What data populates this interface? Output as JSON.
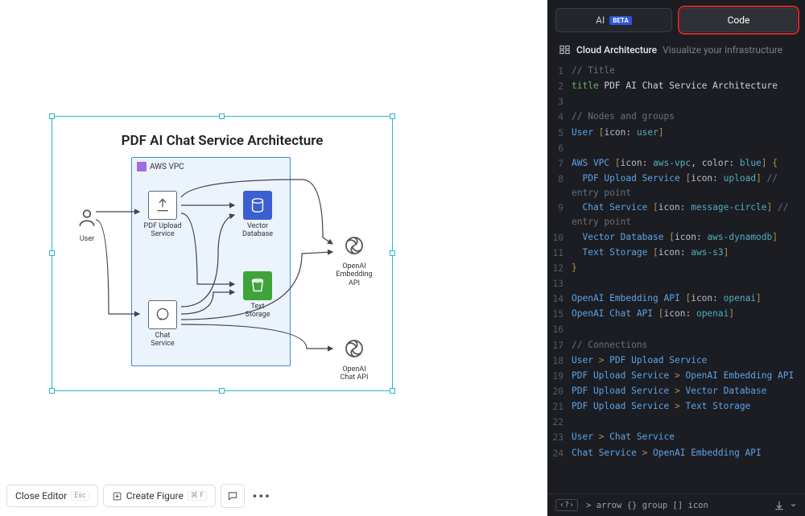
{
  "tabs": {
    "ai": "AI",
    "beta": "BETA",
    "code": "Code"
  },
  "header": {
    "title": "Cloud Architecture",
    "subtitle": "Visualize your infrastructure"
  },
  "diagram": {
    "title": "PDF AI Chat Service Architecture",
    "vpc_label": "AWS VPC",
    "nodes": {
      "user": "User",
      "pdf_upload": "PDF Upload Service",
      "vector_db": "Vector Database",
      "text_storage": "Text Storage",
      "chat_service": "Chat Service",
      "openai_emb": "OpenAI Embedding API",
      "openai_chat": "OpenAI Chat API"
    }
  },
  "toolbar": {
    "close_editor": "Close Editor",
    "close_kbd": "Esc",
    "create_figure": "Create Figure",
    "figure_kbd": "⌘ F"
  },
  "footer": {
    "lang_hint": "‹?›",
    "hint": "> arrow {} group [] icon"
  },
  "code": [
    {
      "n": 1,
      "segs": [
        {
          "c": "cmt",
          "t": "// Title"
        }
      ]
    },
    {
      "n": 2,
      "segs": [
        {
          "c": "kw",
          "t": "title"
        },
        {
          "c": "txt",
          "t": " PDF AI Chat Service Architecture"
        }
      ]
    },
    {
      "n": 3,
      "segs": [
        {
          "c": "",
          "t": ""
        }
      ]
    },
    {
      "n": 4,
      "segs": [
        {
          "c": "cmt",
          "t": "// Nodes and groups"
        }
      ]
    },
    {
      "n": 5,
      "segs": [
        {
          "c": "name",
          "t": "User "
        },
        {
          "c": "brkt",
          "t": "["
        },
        {
          "c": "iconv",
          "t": "icon: "
        },
        {
          "c": "punct",
          "t": "user"
        },
        {
          "c": "brkt",
          "t": "]"
        }
      ]
    },
    {
      "n": 6,
      "segs": [
        {
          "c": "",
          "t": ""
        }
      ]
    },
    {
      "n": 7,
      "segs": [
        {
          "c": "name",
          "t": "AWS VPC "
        },
        {
          "c": "brkt",
          "t": "["
        },
        {
          "c": "iconv",
          "t": "icon: "
        },
        {
          "c": "punct",
          "t": "aws-vpc"
        },
        {
          "c": "iconv",
          "t": ", color: "
        },
        {
          "c": "punct",
          "t": "blue"
        },
        {
          "c": "brkt",
          "t": "]"
        },
        {
          "c": "brkt",
          "t": " {"
        }
      ]
    },
    {
      "n": 8,
      "segs": [
        {
          "c": "",
          "t": "  "
        },
        {
          "c": "name",
          "t": "PDF Upload Service "
        },
        {
          "c": "brkt",
          "t": "["
        },
        {
          "c": "iconv",
          "t": "icon: "
        },
        {
          "c": "punct",
          "t": "upload"
        },
        {
          "c": "brkt",
          "t": "]"
        },
        {
          "c": "cmt",
          "t": " // entry point"
        }
      ]
    },
    {
      "n": 9,
      "segs": [
        {
          "c": "",
          "t": "  "
        },
        {
          "c": "name",
          "t": "Chat Service "
        },
        {
          "c": "brkt",
          "t": "["
        },
        {
          "c": "iconv",
          "t": "icon: "
        },
        {
          "c": "punct",
          "t": "message-circle"
        },
        {
          "c": "brkt",
          "t": "]"
        },
        {
          "c": "cmt",
          "t": " // entry point"
        }
      ]
    },
    {
      "n": 10,
      "segs": [
        {
          "c": "",
          "t": "  "
        },
        {
          "c": "name",
          "t": "Vector Database "
        },
        {
          "c": "brkt",
          "t": "["
        },
        {
          "c": "iconv",
          "t": "icon: "
        },
        {
          "c": "punct",
          "t": "aws-dynamodb"
        },
        {
          "c": "brkt",
          "t": "]"
        }
      ]
    },
    {
      "n": 11,
      "segs": [
        {
          "c": "",
          "t": "  "
        },
        {
          "c": "name",
          "t": "Text Storage "
        },
        {
          "c": "brkt",
          "t": "["
        },
        {
          "c": "iconv",
          "t": "icon: "
        },
        {
          "c": "punct",
          "t": "aws-s3"
        },
        {
          "c": "brkt",
          "t": "]"
        }
      ]
    },
    {
      "n": 12,
      "segs": [
        {
          "c": "brkt",
          "t": "}"
        }
      ]
    },
    {
      "n": 13,
      "segs": [
        {
          "c": "",
          "t": ""
        }
      ]
    },
    {
      "n": 14,
      "segs": [
        {
          "c": "name",
          "t": "OpenAI Embedding API "
        },
        {
          "c": "brkt",
          "t": "["
        },
        {
          "c": "iconv",
          "t": "icon: "
        },
        {
          "c": "punct",
          "t": "openai"
        },
        {
          "c": "brkt",
          "t": "]"
        }
      ]
    },
    {
      "n": 15,
      "segs": [
        {
          "c": "name",
          "t": "OpenAI Chat API "
        },
        {
          "c": "brkt",
          "t": "["
        },
        {
          "c": "iconv",
          "t": "icon: "
        },
        {
          "c": "punct",
          "t": "openai"
        },
        {
          "c": "brkt",
          "t": "]"
        }
      ]
    },
    {
      "n": 16,
      "segs": [
        {
          "c": "",
          "t": ""
        }
      ]
    },
    {
      "n": 17,
      "segs": [
        {
          "c": "cmt",
          "t": "// Connections"
        }
      ]
    },
    {
      "n": 18,
      "segs": [
        {
          "c": "name",
          "t": "User "
        },
        {
          "c": "brkt",
          "t": "> "
        },
        {
          "c": "name",
          "t": "PDF Upload Service"
        }
      ]
    },
    {
      "n": 19,
      "segs": [
        {
          "c": "name",
          "t": "PDF Upload Service "
        },
        {
          "c": "brkt",
          "t": "> "
        },
        {
          "c": "name",
          "t": "OpenAI Embedding API"
        }
      ]
    },
    {
      "n": 20,
      "segs": [
        {
          "c": "name",
          "t": "PDF Upload Service "
        },
        {
          "c": "brkt",
          "t": "> "
        },
        {
          "c": "name",
          "t": "Vector Database"
        }
      ]
    },
    {
      "n": 21,
      "segs": [
        {
          "c": "name",
          "t": "PDF Upload Service "
        },
        {
          "c": "brkt",
          "t": "> "
        },
        {
          "c": "name",
          "t": "Text Storage"
        }
      ]
    },
    {
      "n": 22,
      "segs": [
        {
          "c": "",
          "t": ""
        }
      ]
    },
    {
      "n": 23,
      "segs": [
        {
          "c": "name",
          "t": "User "
        },
        {
          "c": "brkt",
          "t": "> "
        },
        {
          "c": "name",
          "t": "Chat Service"
        }
      ]
    },
    {
      "n": 24,
      "segs": [
        {
          "c": "name",
          "t": "Chat Service "
        },
        {
          "c": "brkt",
          "t": "> "
        },
        {
          "c": "name",
          "t": "OpenAI Embedding API"
        }
      ]
    }
  ]
}
